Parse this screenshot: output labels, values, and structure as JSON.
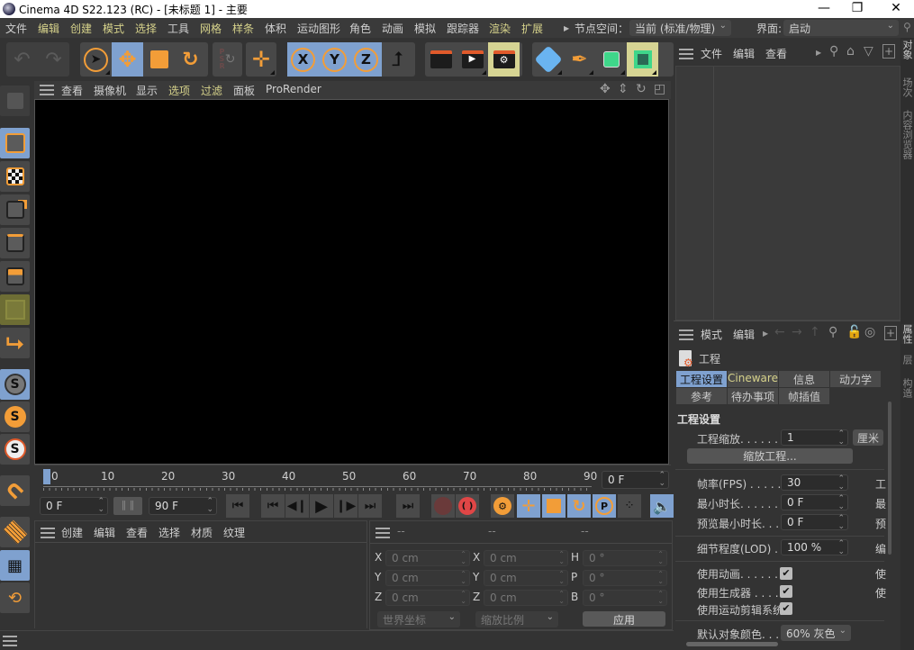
{
  "window": {
    "title": "Cinema 4D S22.123 (RC) - [未标题 1] - 主要",
    "minimize": "—",
    "maximize": "❐",
    "close": "✕"
  },
  "menubar": {
    "items": [
      "文件",
      "编辑",
      "创建",
      "模式",
      "选择",
      "工具",
      "网格",
      "样条",
      "体积",
      "运动图形",
      "角色",
      "动画",
      "模拟",
      "跟踪器",
      "渲染",
      "扩展"
    ],
    "node_space_label": "节点空间：",
    "node_space_value": "当前 (标准/物理)",
    "interface_label": "界面:",
    "interface_value": "启动"
  },
  "toolbar": {
    "axis_x": "X",
    "axis_y": "Y",
    "axis_z": "Z",
    "psr": "P\nS\nR"
  },
  "viewport": {
    "menu": [
      "查看",
      "摄像机",
      "显示",
      "选项",
      "过滤",
      "面板",
      "ProRender"
    ]
  },
  "timeline": {
    "ticks": [
      "0",
      "10",
      "20",
      "30",
      "40",
      "50",
      "60",
      "70",
      "80",
      "90"
    ],
    "current_frame": "0 F",
    "start_frame": "0 F",
    "end_frame": "90 F",
    "frame_right": "0 F",
    "progress": 0
  },
  "material_panel": {
    "menu": [
      "创建",
      "编辑",
      "查看",
      "选择",
      "材质",
      "纹理"
    ]
  },
  "coord_panel": {
    "headers": [
      "--",
      "--",
      "--"
    ],
    "rows": [
      {
        "l1": "X",
        "v1": "0 cm",
        "l2": "X",
        "v2": "0 cm",
        "l3": "H",
        "v3": "0 °"
      },
      {
        "l1": "Y",
        "v1": "0 cm",
        "l2": "Y",
        "v2": "0 cm",
        "l3": "P",
        "v3": "0 °"
      },
      {
        "l1": "Z",
        "v1": "0 cm",
        "l2": "Z",
        "v2": "0 cm",
        "l3": "B",
        "v3": "0 °"
      }
    ],
    "coord_mode": "世界坐标",
    "scale_mode": "缩放比例",
    "apply": "应用"
  },
  "object_panel": {
    "menu": [
      "文件",
      "编辑",
      "查看"
    ]
  },
  "attr_panel": {
    "menu": [
      "模式",
      "编辑"
    ],
    "object_name": "工程",
    "tabs_row1": [
      "工程设置",
      "Cineware",
      "信息",
      "动力学"
    ],
    "tabs_row2": [
      "参考",
      "待办事项",
      "帧插值"
    ],
    "section_title": "工程设置",
    "project_scale_label": "工程缩放. . . . . .",
    "project_scale_value": "1",
    "project_scale_unit": "厘米",
    "scale_project_button": "缩放工程...",
    "fps_label": "帧率(FPS) . . . . .",
    "fps_value": "30",
    "fps_side": "工",
    "min_time_label": "最小时长. . . . . . .",
    "min_time_value": "0 F",
    "min_time_side": "最",
    "preview_min_label": "预览最小时长. . .",
    "preview_min_value": "0 F",
    "preview_min_side": "预",
    "lod_label": "细节程度(LOD) .",
    "lod_value": "100 %",
    "lod_side": "编",
    "use_anim_label": "使用动画. . . . . . .",
    "use_anim_checked": true,
    "use_anim_side": "使",
    "use_gen_label": "使用生成器 . . . .",
    "use_gen_checked": true,
    "use_gen_side": "使",
    "use_motion_label": "使用运动剪辑系统",
    "use_motion_checked": true,
    "default_color_label": "默认对象颜色. . .",
    "default_color_value": "60% 灰色"
  },
  "side_tabs": [
    "对象",
    "场次",
    "内容浏览器",
    "属性",
    "层",
    "构造"
  ],
  "check_mark": "✔"
}
